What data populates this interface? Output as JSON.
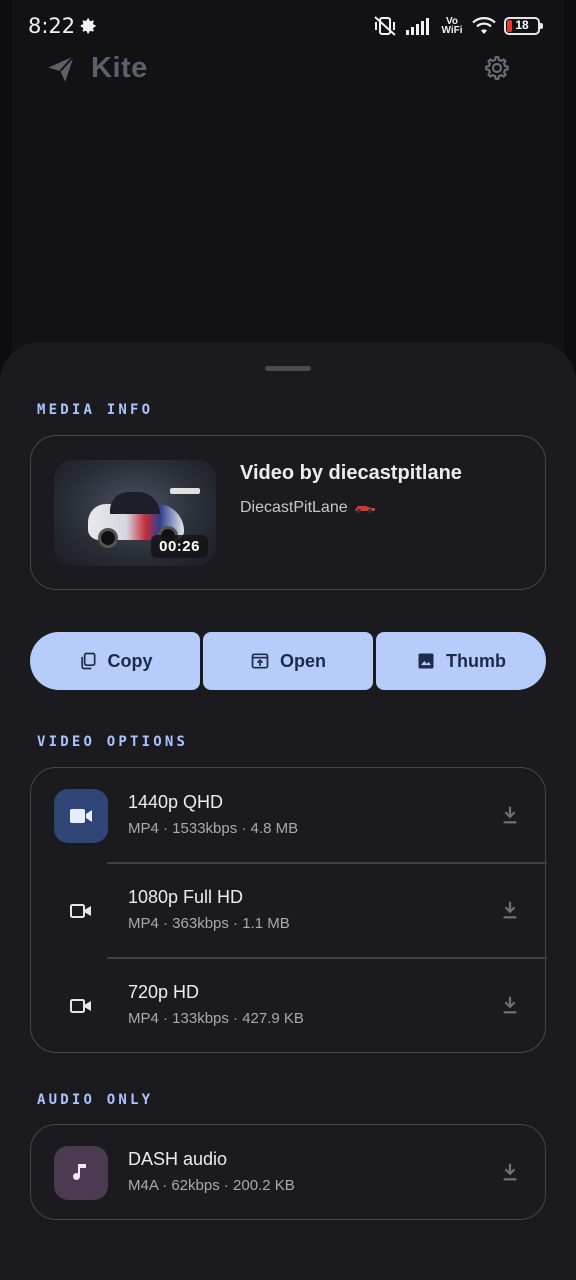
{
  "status_bar": {
    "time": "8:22",
    "network_label": "Vo WiFi",
    "battery_level": "18",
    "battery_color": "#e53935"
  },
  "app": {
    "name": "Kite",
    "accent": "#aac4ff"
  },
  "media_info": {
    "section_label": "MEDIA INFO",
    "title": "Video by diecastpitlane",
    "author": "DiecastPitLane",
    "duration": "00:26"
  },
  "actions": {
    "copy_label": "Copy",
    "open_label": "Open",
    "thumb_label": "Thumb"
  },
  "video_options": {
    "section_label": "VIDEO OPTIONS",
    "items": [
      {
        "title": "1440p QHD",
        "details": "MP4 · 1533kbps · 4.8 MB"
      },
      {
        "title": "1080p Full HD",
        "details": "MP4 · 363kbps · 1.1 MB"
      },
      {
        "title": "720p HD",
        "details": "MP4 · 133kbps · 427.9 KB"
      }
    ]
  },
  "audio_only": {
    "section_label": "AUDIO ONLY",
    "items": [
      {
        "title": "DASH audio",
        "details": "M4A · 62kbps · 200.2 KB"
      }
    ]
  }
}
